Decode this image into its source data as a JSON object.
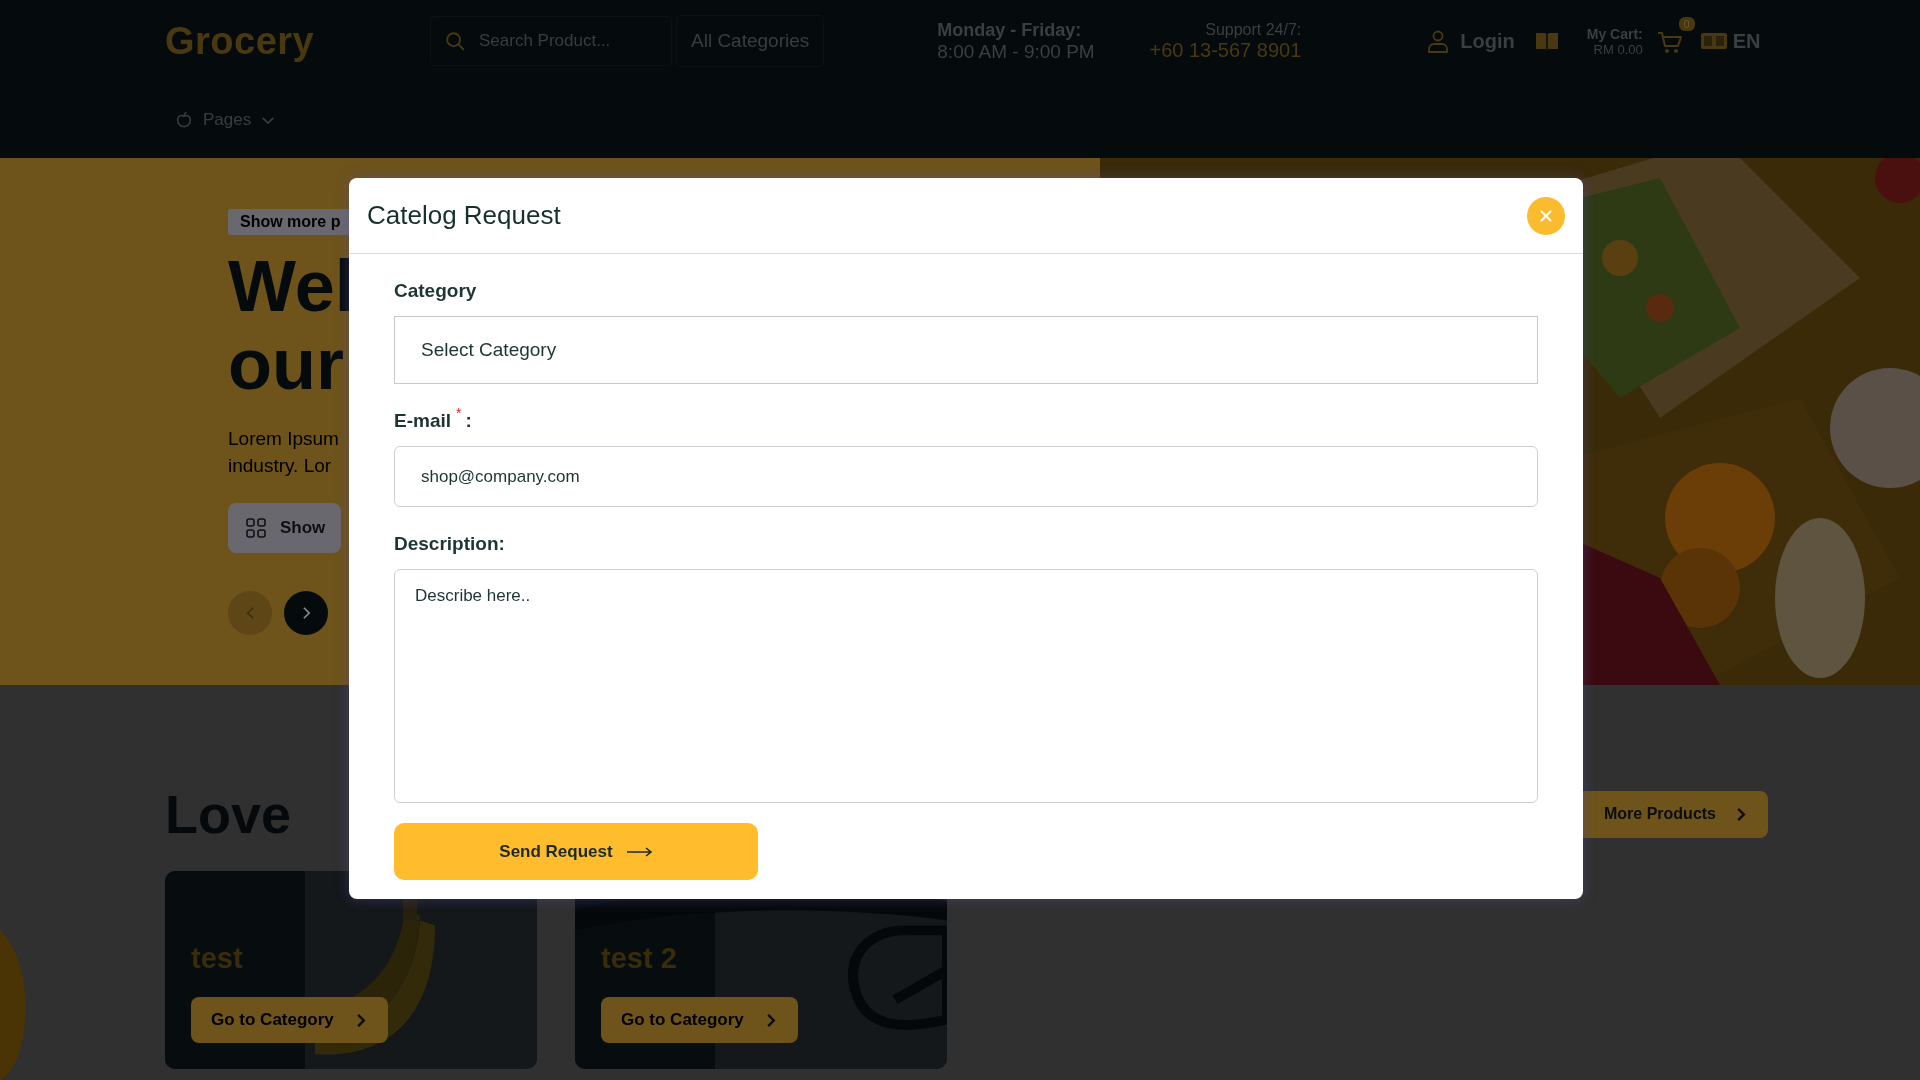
{
  "header": {
    "logo": "Grocery",
    "search": {
      "placeholder": "Search Product..."
    },
    "category_select": "All Categories",
    "hours": {
      "days": "Monday - Friday:",
      "time": "8:00 AM - 9:00 PM"
    },
    "support": {
      "label": "Support 24/7:",
      "phone": "+60 13-567 8901"
    },
    "login": "Login",
    "cart": {
      "label": "My Cart:",
      "total": "RM 0.00",
      "count": "0"
    },
    "language": "EN",
    "nav": [
      {
        "label": "Pages"
      }
    ]
  },
  "hero": {
    "badge": "Show more p",
    "title_lines": [
      "Wel",
      "our"
    ],
    "text_lines": [
      "Lorem Ipsum",
      "industry. Lor"
    ],
    "button": "Show",
    "slider_controls": [
      {
        "kind": "prev",
        "disabled": true
      },
      {
        "kind": "next",
        "disabled": false
      }
    ]
  },
  "section": {
    "title": "Love",
    "more_button": "More Products",
    "cards": [
      {
        "title": "test",
        "button": "Go to Category"
      },
      {
        "title": "test 2",
        "button": "Go to Category"
      }
    ]
  },
  "modal": {
    "title": "Catelog Request",
    "fields": [
      {
        "kind": "select",
        "label": "Category",
        "value": "Select Category"
      },
      {
        "kind": "input",
        "label": "E-mail",
        "required_mark": "*",
        "label_suffix": ":",
        "placeholder": "shop@company.com"
      },
      {
        "kind": "textarea",
        "label": "Description:",
        "placeholder": "Describe here.."
      }
    ],
    "submit": "Send Request"
  }
}
